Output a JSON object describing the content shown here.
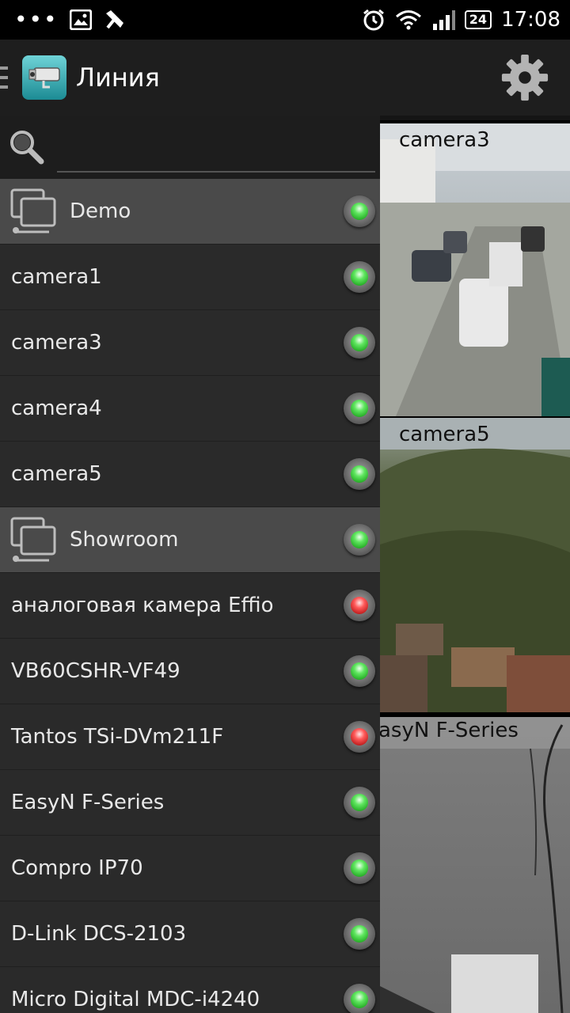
{
  "status_bar": {
    "battery": "24",
    "time": "17:08"
  },
  "action_bar": {
    "title": "Линия"
  },
  "search": {
    "placeholder": ""
  },
  "drawer": {
    "rows": [
      {
        "type": "group",
        "label": "Demo",
        "status": "green"
      },
      {
        "type": "camera",
        "label": "camera1",
        "status": "green"
      },
      {
        "type": "camera",
        "label": "camera3",
        "status": "green"
      },
      {
        "type": "camera",
        "label": "camera4",
        "status": "green"
      },
      {
        "type": "camera",
        "label": "camera5",
        "status": "green"
      },
      {
        "type": "group",
        "label": "Showroom",
        "status": "green"
      },
      {
        "type": "camera",
        "label": "аналоговая камера Effio",
        "status": "red"
      },
      {
        "type": "camera",
        "label": "VB60CSHR-VF49",
        "status": "green"
      },
      {
        "type": "camera",
        "label": "Tantos TSi-DVm211F",
        "status": "red"
      },
      {
        "type": "camera",
        "label": "EasyN F-Series",
        "status": "green"
      },
      {
        "type": "camera",
        "label": "Compro IP70",
        "status": "green"
      },
      {
        "type": "camera",
        "label": "D-Link DCS-2103",
        "status": "green"
      },
      {
        "type": "camera",
        "label": "Micro Digital MDC-i4240",
        "status": "green"
      }
    ]
  },
  "feeds": [
    {
      "caption": "camera3"
    },
    {
      "caption": "camera5"
    },
    {
      "caption": "asyN F-Series"
    }
  ],
  "colors": {
    "status_green": "#2ecc40",
    "status_red": "#e0302a",
    "group_row_bg": "#4a4a4a",
    "drawer_bg": "#2a2a2a"
  }
}
